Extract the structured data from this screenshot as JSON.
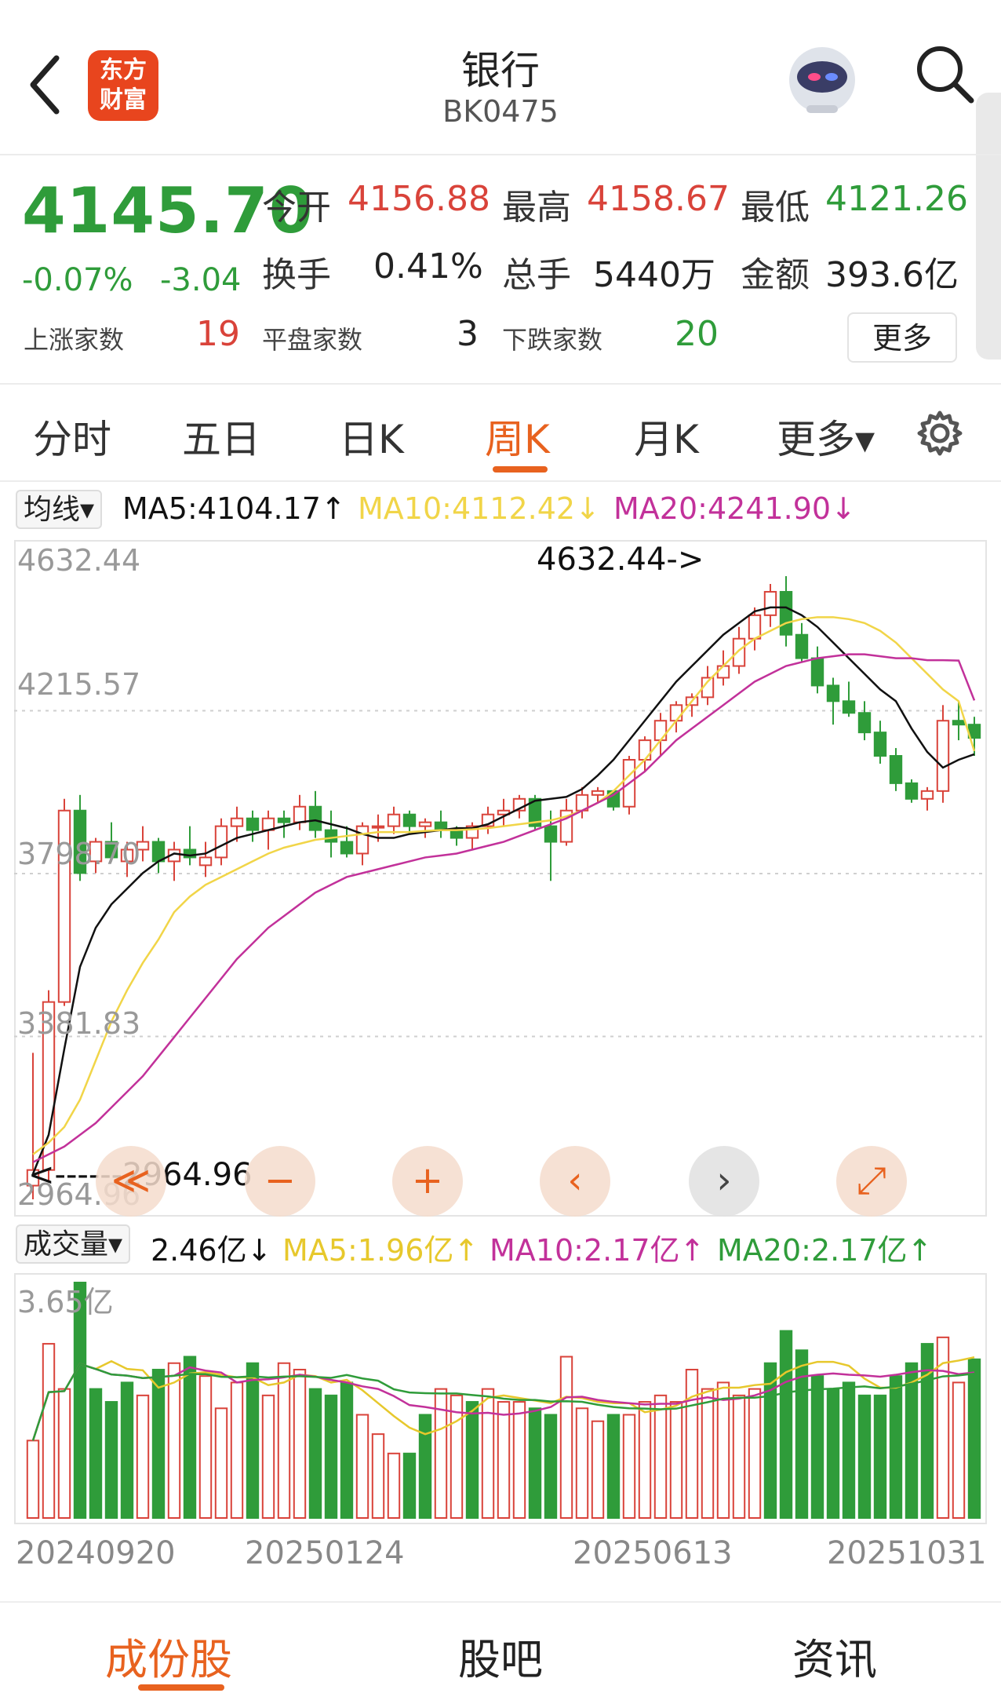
{
  "header": {
    "title": "银行",
    "code": "BK0475",
    "logo_line1": "东方",
    "logo_line2": "财富"
  },
  "quote": {
    "price": "4145.70",
    "change_pct": "-0.07%",
    "change": "-3.04",
    "open_label": "今开",
    "open": "4156.88",
    "high_label": "最高",
    "high": "4158.67",
    "low_label": "最低",
    "low": "4121.26",
    "turnover_label": "换手",
    "turnover": "0.41%",
    "volume_label": "总手",
    "volume": "5440万",
    "amount_label": "金额",
    "amount": "393.6亿",
    "up_label": "上涨家数",
    "up_count": "19",
    "flat_label": "平盘家数",
    "flat_count": "3",
    "down_label": "下跌家数",
    "down_count": "20",
    "more_button": "更多"
  },
  "tabs": {
    "fenshi": "分时",
    "wuri": "五日",
    "rik": "日K",
    "zhouk": "周K",
    "yuek": "月K",
    "more": "更多▾"
  },
  "ma": {
    "selector": "均线▾",
    "ma5": "MA5:4104.17↑",
    "ma10": "MA10:4112.42↓",
    "ma20": "MA20:4241.90↓"
  },
  "vol": {
    "selector": "成交量▾",
    "current": "2.46亿↓",
    "ma5": "MA5:1.96亿↑",
    "ma10": "MA10:2.17亿↑",
    "ma20": "MA20:2.17亿↑",
    "max_label": "3.65亿"
  },
  "axis": {
    "y1": "4632.44",
    "y2": "4215.57",
    "y3": "3798.70",
    "y4": "3381.83",
    "y5": "2964.96",
    "max_note": "4632.44->",
    "min_note": "<------2964.96"
  },
  "dates": [
    "20240920",
    "20250124",
    "20250613",
    "20251031"
  ],
  "controls": {
    "prev_fast": "≪",
    "zoom_out": "−",
    "zoom_in": "+",
    "prev": "‹",
    "next": "›",
    "fullscreen": "⤢"
  },
  "nav": {
    "constituents": "成份股",
    "forum": "股吧",
    "news": "资讯"
  },
  "colors": {
    "up": "#d9433a",
    "down": "#2f9c3a",
    "accent": "#e8621f",
    "ma5": "#111111",
    "ma10": "#f1d548",
    "ma20": "#c2319a"
  },
  "chart_data": {
    "type": "candlestick",
    "ylim": [
      2964.96,
      4632.44
    ],
    "highest": 4632.44,
    "lowest": 2964.96,
    "series": [
      {
        "name": "K",
        "ohlc": [
          [
            3000,
            3340,
            2965,
            3040
          ],
          [
            3040,
            3500,
            3010,
            3470
          ],
          [
            3470,
            3990,
            3460,
            3960
          ],
          [
            3960,
            4000,
            3780,
            3800
          ],
          [
            3830,
            3890,
            3800,
            3880
          ],
          [
            3880,
            3930,
            3830,
            3840
          ],
          [
            3830,
            3880,
            3790,
            3860
          ],
          [
            3860,
            3920,
            3830,
            3880
          ],
          [
            3880,
            3890,
            3800,
            3830
          ],
          [
            3830,
            3880,
            3780,
            3860
          ],
          [
            3860,
            3920,
            3820,
            3840
          ],
          [
            3820,
            3880,
            3790,
            3840
          ],
          [
            3840,
            3940,
            3820,
            3920
          ],
          [
            3920,
            3970,
            3880,
            3940
          ],
          [
            3940,
            3960,
            3880,
            3910
          ],
          [
            3910,
            3960,
            3860,
            3940
          ],
          [
            3940,
            3960,
            3890,
            3930
          ],
          [
            3930,
            4000,
            3910,
            3970
          ],
          [
            3970,
            4010,
            3890,
            3910
          ],
          [
            3910,
            3960,
            3840,
            3880
          ],
          [
            3880,
            3920,
            3840,
            3850
          ],
          [
            3850,
            3930,
            3820,
            3920
          ],
          [
            3920,
            3950,
            3880,
            3920
          ],
          [
            3920,
            3970,
            3900,
            3950
          ],
          [
            3950,
            3960,
            3900,
            3920
          ],
          [
            3920,
            3940,
            3890,
            3930
          ],
          [
            3930,
            3960,
            3890,
            3910
          ],
          [
            3910,
            3920,
            3870,
            3890
          ],
          [
            3890,
            3930,
            3860,
            3920
          ],
          [
            3920,
            3970,
            3900,
            3950
          ],
          [
            3950,
            3990,
            3920,
            3960
          ],
          [
            3960,
            4000,
            3940,
            3990
          ],
          [
            3990,
            4000,
            3910,
            3920
          ],
          [
            3920,
            3960,
            3780,
            3880
          ],
          [
            3880,
            3990,
            3870,
            3960
          ],
          [
            3960,
            4020,
            3940,
            4000
          ],
          [
            4000,
            4020,
            3980,
            4010
          ],
          [
            4010,
            4010,
            3960,
            3970
          ],
          [
            3970,
            4100,
            3950,
            4090
          ],
          [
            4090,
            4150,
            4060,
            4140
          ],
          [
            4140,
            4210,
            4100,
            4190
          ],
          [
            4190,
            4240,
            4160,
            4230
          ],
          [
            4230,
            4260,
            4200,
            4250
          ],
          [
            4250,
            4330,
            4230,
            4300
          ],
          [
            4300,
            4370,
            4280,
            4330
          ],
          [
            4330,
            4430,
            4310,
            4400
          ],
          [
            4400,
            4480,
            4370,
            4460
          ],
          [
            4460,
            4540,
            4430,
            4520
          ],
          [
            4520,
            4560,
            4380,
            4410
          ],
          [
            4410,
            4440,
            4340,
            4350
          ],
          [
            4350,
            4380,
            4260,
            4280
          ],
          [
            4280,
            4300,
            4180,
            4240
          ],
          [
            4240,
            4290,
            4200,
            4210
          ],
          [
            4210,
            4240,
            4140,
            4160
          ],
          [
            4160,
            4190,
            4080,
            4100
          ],
          [
            4100,
            4120,
            4010,
            4030
          ],
          [
            4030,
            4040,
            3980,
            3990
          ],
          [
            3990,
            4020,
            3960,
            4010
          ],
          [
            4010,
            4230,
            3980,
            4190
          ],
          [
            4190,
            4240,
            4140,
            4180
          ],
          [
            4180,
            4200,
            4100,
            4146
          ]
        ]
      },
      {
        "name": "MA5",
        "values": [
          3030,
          3130,
          3350,
          3560,
          3660,
          3720,
          3760,
          3800,
          3830,
          3850,
          3845,
          3850,
          3870,
          3890,
          3900,
          3910,
          3920,
          3930,
          3935,
          3925,
          3915,
          3900,
          3890,
          3890,
          3900,
          3905,
          3910,
          3915,
          3915,
          3925,
          3945,
          3965,
          3985,
          3990,
          3995,
          4015,
          4050,
          4090,
          4140,
          4190,
          4240,
          4290,
          4330,
          4370,
          4410,
          4440,
          4470,
          4480,
          4480,
          4460,
          4430,
          4390,
          4350,
          4310,
          4270,
          4240,
          4170,
          4110,
          4070,
          4090,
          4104.17
        ]
      },
      {
        "name": "MA10",
        "values": [
          3080,
          3110,
          3150,
          3220,
          3320,
          3420,
          3500,
          3570,
          3630,
          3700,
          3740,
          3770,
          3790,
          3810,
          3830,
          3850,
          3865,
          3875,
          3885,
          3890,
          3895,
          3900,
          3905,
          3905,
          3905,
          3908,
          3910,
          3910,
          3912,
          3915,
          3920,
          3925,
          3930,
          3935,
          3945,
          3960,
          3980,
          4010,
          4050,
          4090,
          4140,
          4190,
          4240,
          4290,
          4330,
          4370,
          4400,
          4420,
          4440,
          4450,
          4455,
          4455,
          4450,
          4440,
          4420,
          4390,
          4350,
          4310,
          4270,
          4240,
          4112.42
        ]
      },
      {
        "name": "MA20",
        "values": [
          3060,
          3080,
          3100,
          3130,
          3160,
          3200,
          3240,
          3280,
          3330,
          3380,
          3430,
          3480,
          3530,
          3580,
          3620,
          3660,
          3690,
          3720,
          3750,
          3770,
          3790,
          3800,
          3810,
          3820,
          3830,
          3840,
          3845,
          3850,
          3860,
          3870,
          3880,
          3895,
          3910,
          3925,
          3940,
          3960,
          3980,
          4000,
          4030,
          4060,
          4100,
          4140,
          4170,
          4200,
          4230,
          4260,
          4290,
          4310,
          4330,
          4340,
          4350,
          4355,
          4360,
          4360,
          4355,
          4350,
          4350,
          4345,
          4345,
          4344,
          4241.9
        ]
      }
    ],
    "volume": [
      1.2,
      2.7,
      2.0,
      3.65,
      2.0,
      1.8,
      2.1,
      1.9,
      2.3,
      2.4,
      2.5,
      2.2,
      1.7,
      2.1,
      2.4,
      1.9,
      2.4,
      2.3,
      2.0,
      1.9,
      2.1,
      1.6,
      1.3,
      1.0,
      1.0,
      1.6,
      2.0,
      1.9,
      1.8,
      2.0,
      1.8,
      1.8,
      1.7,
      1.6,
      2.5,
      1.7,
      1.5,
      1.6,
      1.6,
      1.8,
      1.9,
      1.8,
      2.3,
      2.0,
      2.1,
      1.9,
      2.0,
      2.4,
      2.9,
      2.6,
      2.2,
      2.0,
      2.1,
      1.9,
      1.9,
      2.2,
      2.4,
      2.7,
      2.8,
      2.1,
      2.46
    ],
    "volume_up": [
      true,
      true,
      true,
      false,
      false,
      false,
      false,
      true,
      false,
      true,
      false,
      true,
      true,
      true,
      false,
      true,
      true,
      true,
      false,
      false,
      false,
      true,
      true,
      true,
      false,
      false,
      true,
      true,
      false,
      true,
      true,
      true,
      false,
      false,
      true,
      true,
      true,
      false,
      true,
      true,
      true,
      true,
      true,
      true,
      true,
      true,
      true,
      false,
      false,
      false,
      false,
      false,
      false,
      false,
      false,
      false,
      false,
      false,
      true,
      true,
      false
    ]
  }
}
